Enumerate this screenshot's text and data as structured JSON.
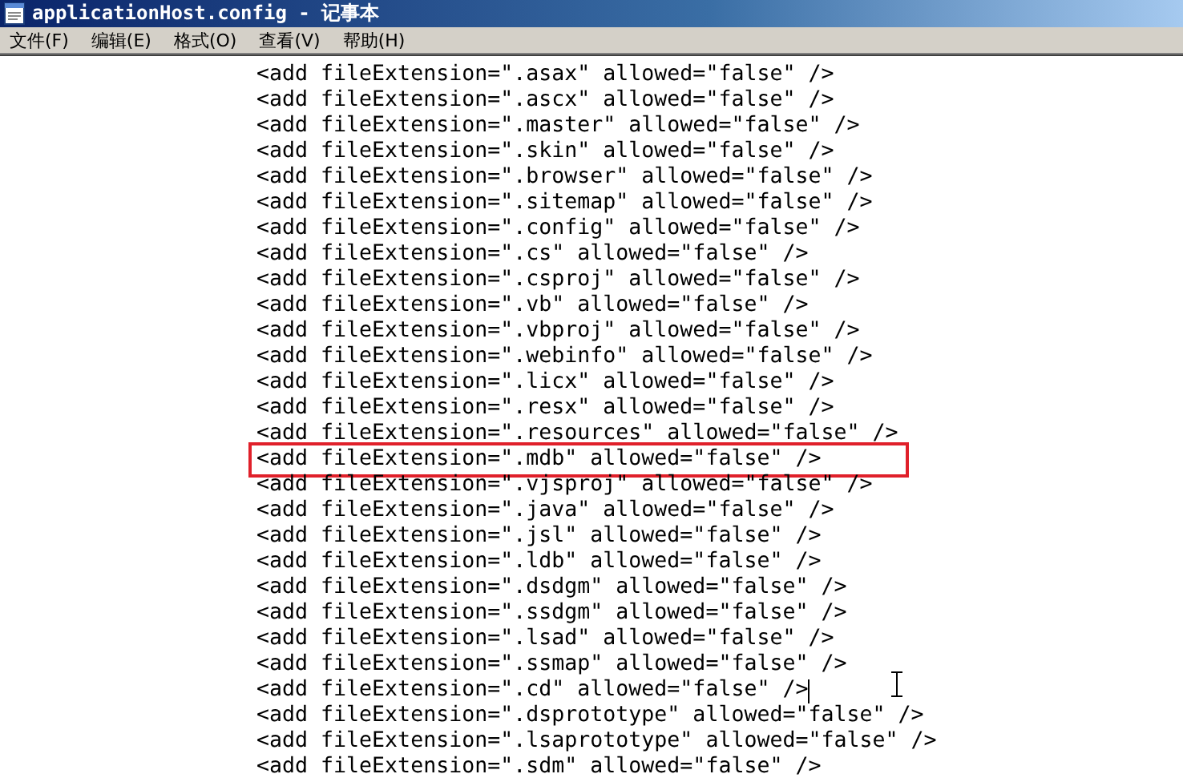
{
  "window": {
    "title": "applicationHost.config - 记事本"
  },
  "menu": [
    {
      "label": "文件(F)"
    },
    {
      "label": "编辑(E)"
    },
    {
      "label": "格式(O)"
    },
    {
      "label": "查看(V)"
    },
    {
      "label": "帮助(H)"
    }
  ],
  "editor": {
    "lines": [
      {
        "text": "<add fileExtension=\".asax\" allowed=\"false\" />",
        "highlighted": false,
        "caret": false
      },
      {
        "text": "<add fileExtension=\".ascx\" allowed=\"false\" />",
        "highlighted": false,
        "caret": false
      },
      {
        "text": "<add fileExtension=\".master\" allowed=\"false\" />",
        "highlighted": false,
        "caret": false
      },
      {
        "text": "<add fileExtension=\".skin\" allowed=\"false\" />",
        "highlighted": false,
        "caret": false
      },
      {
        "text": "<add fileExtension=\".browser\" allowed=\"false\" />",
        "highlighted": false,
        "caret": false
      },
      {
        "text": "<add fileExtension=\".sitemap\" allowed=\"false\" />",
        "highlighted": false,
        "caret": false
      },
      {
        "text": "<add fileExtension=\".config\" allowed=\"false\" />",
        "highlighted": false,
        "caret": false
      },
      {
        "text": "<add fileExtension=\".cs\" allowed=\"false\" />",
        "highlighted": false,
        "caret": false
      },
      {
        "text": "<add fileExtension=\".csproj\" allowed=\"false\" />",
        "highlighted": false,
        "caret": false
      },
      {
        "text": "<add fileExtension=\".vb\" allowed=\"false\" />",
        "highlighted": false,
        "caret": false
      },
      {
        "text": "<add fileExtension=\".vbproj\" allowed=\"false\" />",
        "highlighted": false,
        "caret": false
      },
      {
        "text": "<add fileExtension=\".webinfo\" allowed=\"false\" />",
        "highlighted": false,
        "caret": false
      },
      {
        "text": "<add fileExtension=\".licx\" allowed=\"false\" />",
        "highlighted": false,
        "caret": false
      },
      {
        "text": "<add fileExtension=\".resx\" allowed=\"false\" />",
        "highlighted": false,
        "caret": false
      },
      {
        "text": "<add fileExtension=\".resources\" allowed=\"false\" />",
        "highlighted": false,
        "caret": false
      },
      {
        "text": "<add fileExtension=\".mdb\" allowed=\"false\" />",
        "highlighted": true,
        "caret": false
      },
      {
        "text": "<add fileExtension=\".vjsproj\" allowed=\"false\" />",
        "highlighted": false,
        "caret": false
      },
      {
        "text": "<add fileExtension=\".java\" allowed=\"false\" />",
        "highlighted": false,
        "caret": false
      },
      {
        "text": "<add fileExtension=\".jsl\" allowed=\"false\" />",
        "highlighted": false,
        "caret": false
      },
      {
        "text": "<add fileExtension=\".ldb\" allowed=\"false\" />",
        "highlighted": false,
        "caret": false
      },
      {
        "text": "<add fileExtension=\".dsdgm\" allowed=\"false\" />",
        "highlighted": false,
        "caret": false
      },
      {
        "text": "<add fileExtension=\".ssdgm\" allowed=\"false\" />",
        "highlighted": false,
        "caret": false
      },
      {
        "text": "<add fileExtension=\".lsad\" allowed=\"false\" />",
        "highlighted": false,
        "caret": false
      },
      {
        "text": "<add fileExtension=\".ssmap\" allowed=\"false\" />",
        "highlighted": false,
        "caret": false
      },
      {
        "text": "<add fileExtension=\".cd\" allowed=\"false\" />",
        "highlighted": false,
        "caret": true
      },
      {
        "text": "<add fileExtension=\".dsprototype\" allowed=\"false\" />",
        "highlighted": false,
        "caret": false
      },
      {
        "text": "<add fileExtension=\".lsaprototype\" allowed=\"false\" />",
        "highlighted": false,
        "caret": false
      },
      {
        "text": "<add fileExtension=\".sdm\" allowed=\"false\" />",
        "highlighted": false,
        "caret": false
      }
    ]
  }
}
